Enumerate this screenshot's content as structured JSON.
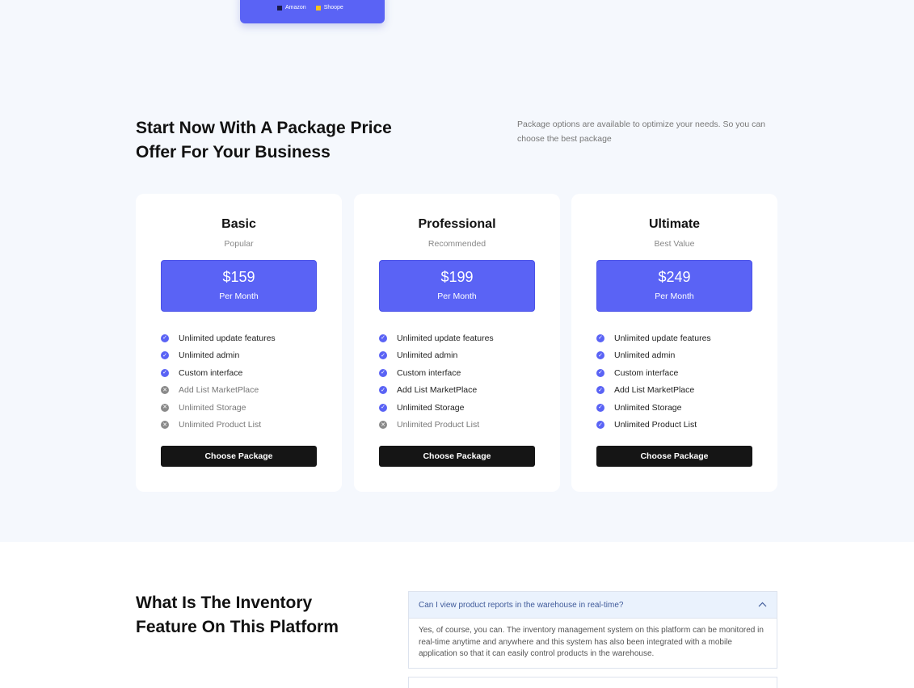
{
  "chart_legend": [
    {
      "label": "Amazon",
      "color": "#1a1a4a"
    },
    {
      "label": "Shoope",
      "color": "#f7c21b"
    }
  ],
  "pricing": {
    "title": "Start Now With A Package Price Offer For Your Business",
    "description": "Package options are available to optimize your needs. So you can choose the best package",
    "button_label": "Choose Package",
    "plans": [
      {
        "name": "Basic",
        "tag": "Popular",
        "price": "$159",
        "period": "Per Month",
        "features": [
          {
            "label": "Unlimited update features",
            "included": true
          },
          {
            "label": "Unlimited admin",
            "included": true
          },
          {
            "label": "Custom interface",
            "included": true
          },
          {
            "label": "Add List MarketPlace",
            "included": false
          },
          {
            "label": "Unlimited Storage",
            "included": false
          },
          {
            "label": "Unlimited Product List",
            "included": false
          }
        ]
      },
      {
        "name": "Professional",
        "tag": "Recommended",
        "price": "$199",
        "period": "Per Month",
        "features": [
          {
            "label": "Unlimited update features",
            "included": true
          },
          {
            "label": "Unlimited admin",
            "included": true
          },
          {
            "label": "Custom interface",
            "included": true
          },
          {
            "label": "Add List MarketPlace",
            "included": true
          },
          {
            "label": "Unlimited Storage",
            "included": true
          },
          {
            "label": "Unlimited Product List",
            "included": false
          }
        ]
      },
      {
        "name": "Ultimate",
        "tag": "Best Value",
        "price": "$249",
        "period": "Per Month",
        "features": [
          {
            "label": "Unlimited update features",
            "included": true
          },
          {
            "label": "Unlimited admin",
            "included": true
          },
          {
            "label": "Custom interface",
            "included": true
          },
          {
            "label": "Add List MarketPlace",
            "included": true
          },
          {
            "label": "Unlimited Storage",
            "included": true
          },
          {
            "label": "Unlimited Product List",
            "included": true
          }
        ]
      }
    ]
  },
  "faq": {
    "title": "What Is The Inventory Feature On This Platform",
    "items": [
      {
        "question": "Can I view product reports in the warehouse in real-time?",
        "answer": "Yes, of course, you can. The inventory management system on this platform can be monitored in real-time anytime and anywhere and this system has also been integrated with a mobile application so that it can easily control products in the warehouse.",
        "expanded": true
      }
    ]
  },
  "colors": {
    "accent": "#5a63f5",
    "button": "#151515",
    "section_bg": "#f5f8fd"
  }
}
